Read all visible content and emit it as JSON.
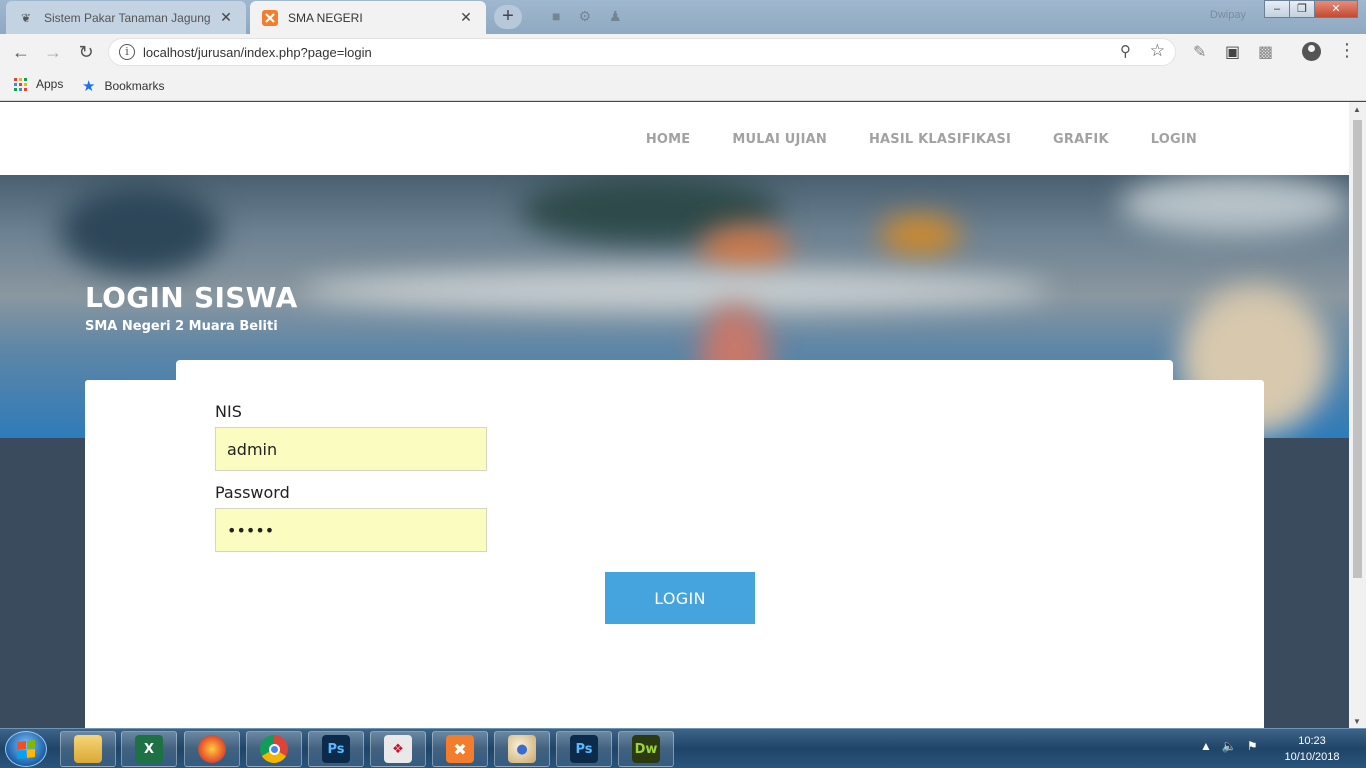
{
  "browser": {
    "tabs": [
      {
        "title": "Sistem Pakar Tanaman Jagung",
        "active": false
      },
      {
        "title": "SMA NEGERI",
        "active": true
      }
    ],
    "ghost_user": "Dwipay",
    "url": "localhost/jurusan/index.php?page=login",
    "bookmarks": {
      "apps": "Apps",
      "bookmarks": "Bookmarks"
    }
  },
  "site": {
    "nav": [
      "HOME",
      "MULAI UJIAN",
      "HASIL KLASIFIKASI",
      "GRAFIK",
      "LOGIN"
    ],
    "hero_title": "LOGIN SISWA",
    "hero_subtitle": "SMA Negeri 2 Muara Beliti",
    "form": {
      "nis_label": "NIS",
      "nis_value": "admin",
      "password_label": "Password",
      "password_value": "admin",
      "submit_label": "LOGIN"
    }
  },
  "taskbar": {
    "apps": [
      "explorer-icon",
      "excel-icon",
      "firefox-icon",
      "chrome-icon",
      "photoshop-icon",
      "acrobat-icon",
      "xampp-icon",
      "paint-icon",
      "photoshop-icon",
      "dreamweaver-icon"
    ],
    "ps_label": "Ps",
    "dw_label": "Dw",
    "time": "10:23",
    "date": "10/10/2018"
  },
  "colors": {
    "accent_button": "#45a3de",
    "input_autofill": "#fbfcc0",
    "page_background": "#3a4b5e",
    "nav_text": "#a2a2a2"
  }
}
